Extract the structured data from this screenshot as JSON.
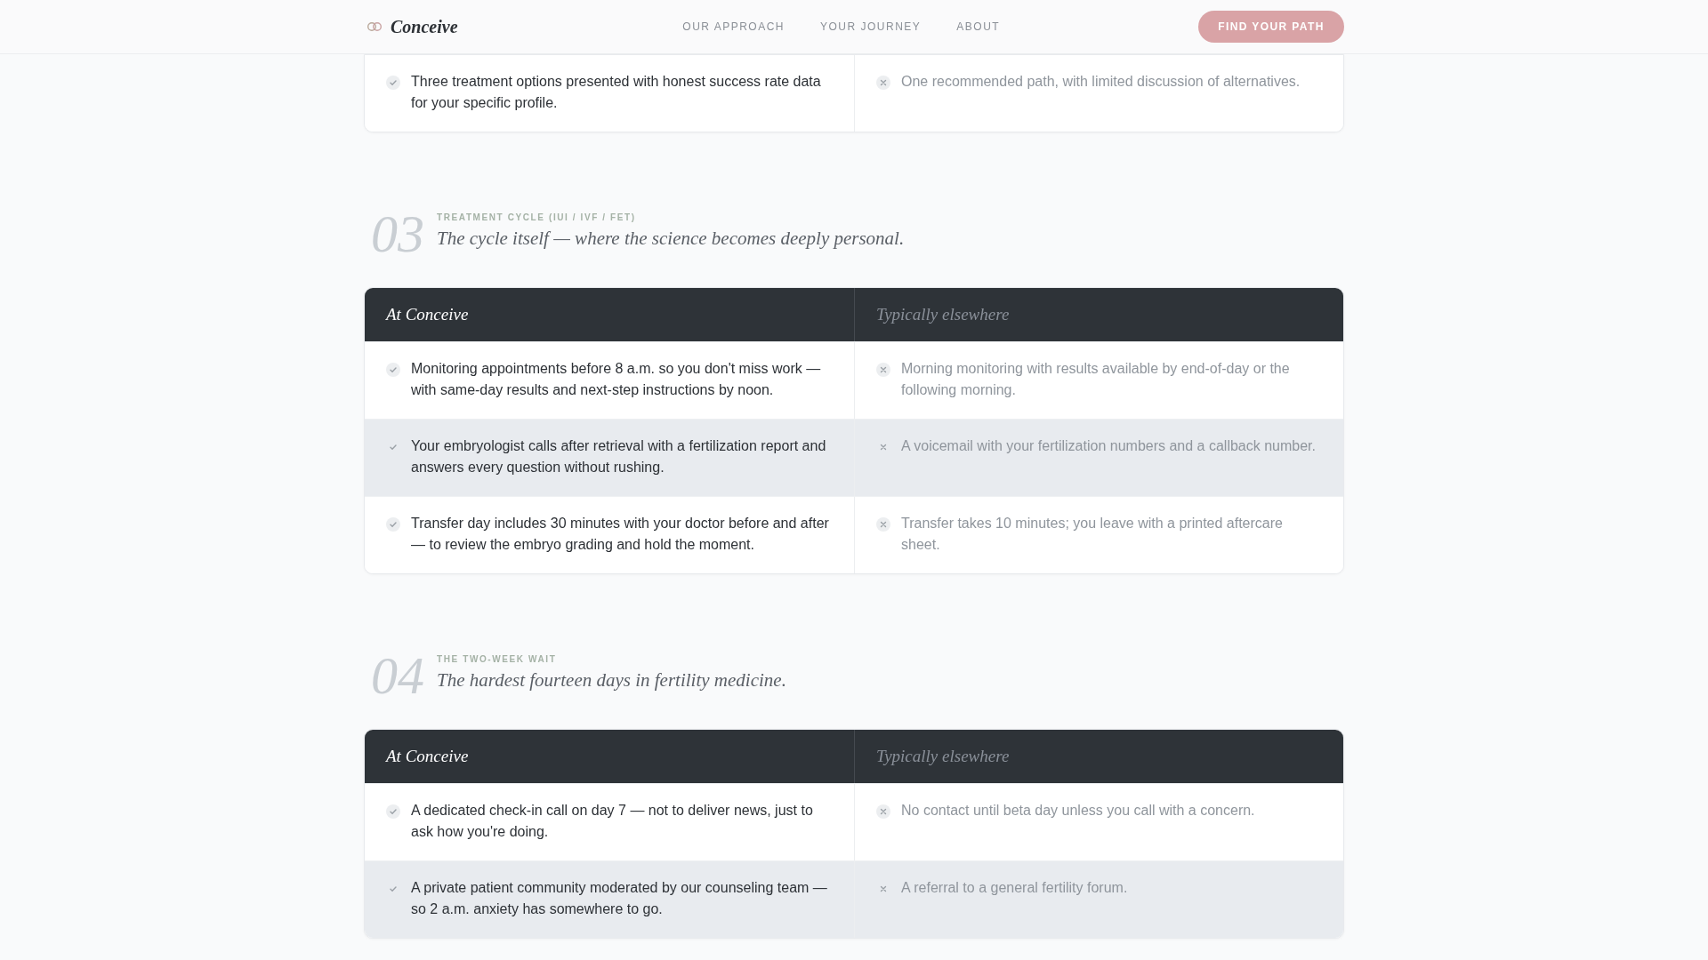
{
  "header": {
    "brand": "Conceive",
    "nav": [
      "OUR APPROACH",
      "YOUR JOURNEY",
      "ABOUT"
    ],
    "cta": "FIND YOUR PATH"
  },
  "sections": [
    {
      "rows": [
        {
          "ours": "Three treatment options presented with honest success rate data for your specific profile.",
          "theirs": "One recommended path, with limited discussion of alternatives.",
          "shaded": false
        }
      ]
    },
    {
      "number": "03",
      "eyebrow": "TREATMENT CYCLE (IUI / IVF / FET)",
      "title": "The cycle itself — where the science becomes deeply personal.",
      "columns": [
        "At Conceive",
        "Typically elsewhere"
      ],
      "rows": [
        {
          "ours": "Monitoring appointments before 8 a.m. so you don't miss work — with same-day results and next-step instructions by noon.",
          "theirs": "Morning monitoring with results available by end-of-day or the following morning.",
          "shaded": false
        },
        {
          "ours": "Your embryologist calls after retrieval with a fertilization report and answers every question without rushing.",
          "theirs": "A voicemail with your fertilization numbers and a callback number.",
          "shaded": true
        },
        {
          "ours": "Transfer day includes 30 minutes with your doctor before and after — to review the embryo grading and hold the moment.",
          "theirs": "Transfer takes 10 minutes; you leave with a printed aftercare sheet.",
          "shaded": false
        }
      ]
    },
    {
      "number": "04",
      "eyebrow": "THE TWO-WEEK WAIT",
      "title": "The hardest fourteen days in fertility medicine.",
      "columns": [
        "At Conceive",
        "Typically elsewhere"
      ],
      "rows": [
        {
          "ours": "A dedicated check-in call on day 7 — not to deliver news, just to ask how you're doing.",
          "theirs": "No contact until beta day unless you call with a concern.",
          "shaded": false
        },
        {
          "ours": "A private patient community moderated by our counseling team — so 2 a.m. anxiety has somewhere to go.",
          "theirs": "A referral to a general fertility forum.",
          "shaded": true
        }
      ]
    }
  ]
}
